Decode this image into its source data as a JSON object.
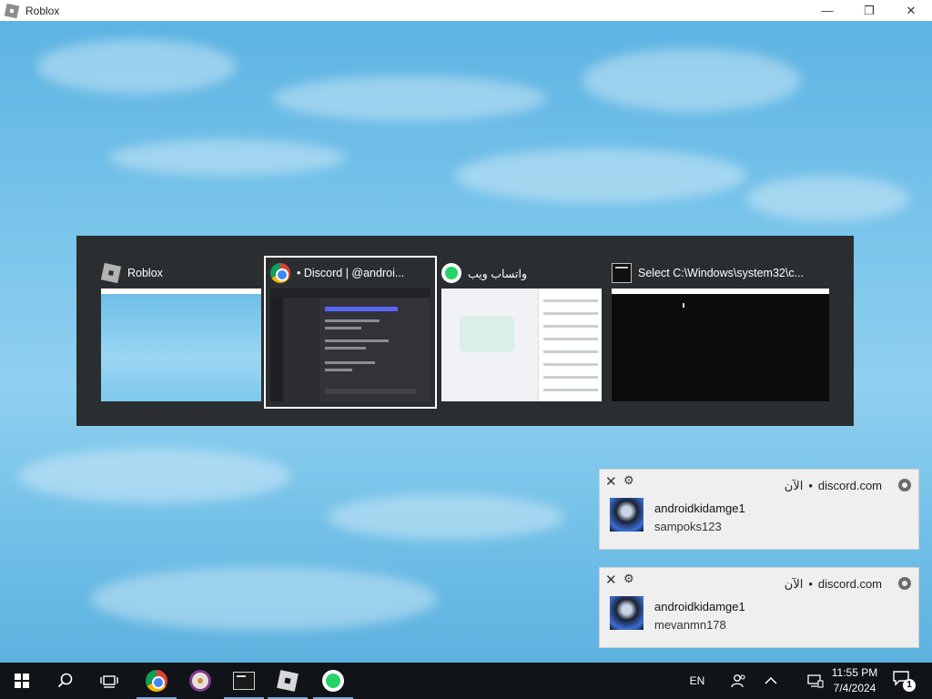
{
  "window": {
    "title": "Roblox",
    "controls": {
      "minimize": "—",
      "restore": "❐",
      "close": "✕"
    }
  },
  "switcher": {
    "items": [
      {
        "label": "Roblox",
        "icon": "roblox-icon"
      },
      {
        "label": "• Discord | @androi...",
        "icon": "chrome-icon",
        "selected": true
      },
      {
        "label": "واتساب ويب",
        "icon": "whatsapp-icon"
      },
      {
        "label": "Select C:\\Windows\\system32\\c...",
        "icon": "cmd-icon"
      }
    ]
  },
  "notifications": [
    {
      "source": "discord.com",
      "dot": "•",
      "time": "الآن",
      "title": "androidkidamge1",
      "body": "sampoks123"
    },
    {
      "source": "discord.com",
      "dot": "•",
      "time": "الآن",
      "title": "androidkidamge1",
      "body": "mevanmn178"
    }
  ],
  "taskbar": {
    "language": "EN",
    "time": "11:55 PM",
    "date": "7/4/2024",
    "notification_count": "1"
  }
}
